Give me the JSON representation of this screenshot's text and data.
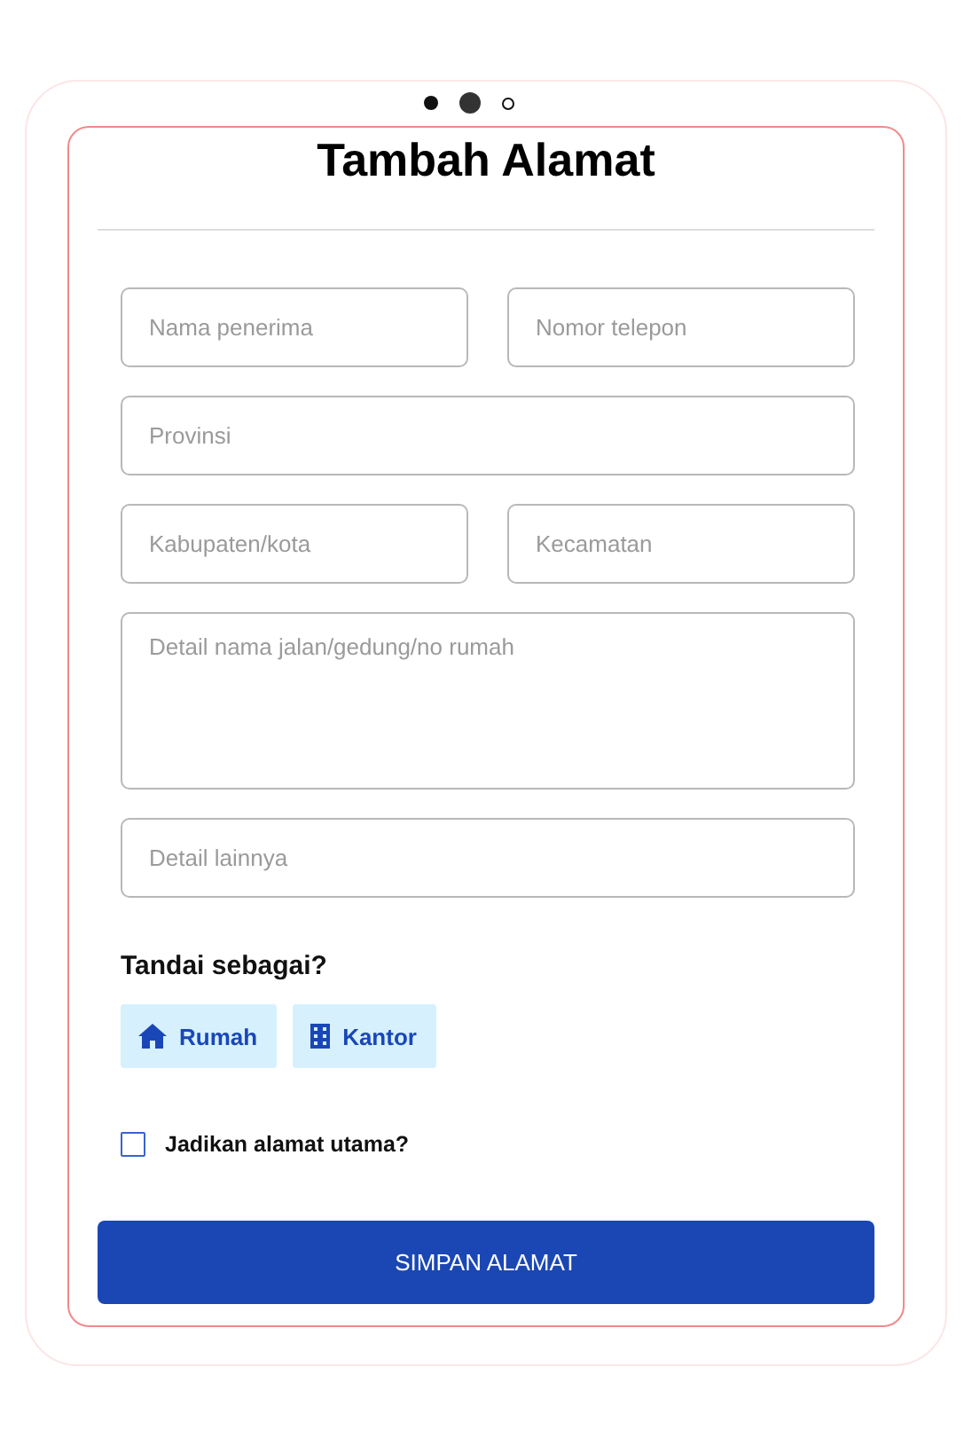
{
  "title": "Tambah Alamat",
  "fields": [
    {
      "placeholder": "Nama penerima",
      "kind": "half"
    },
    {
      "placeholder": "Nomor telepon",
      "kind": "half"
    },
    {
      "placeholder": "Provinsi",
      "kind": "full"
    },
    {
      "placeholder": "Kabupaten/kota",
      "kind": "half"
    },
    {
      "placeholder": "Kecamatan",
      "kind": "half"
    },
    {
      "placeholder": "Detail nama jalan/gedung/no rumah",
      "kind": "textarea"
    },
    {
      "placeholder": "Detail lainnya",
      "kind": "full"
    }
  ],
  "tag_section": {
    "label": "Tandai sebagai?",
    "tags": [
      {
        "label": "Rumah",
        "kind": "house",
        "selected": false
      },
      {
        "label": "Kantor",
        "kind": "building",
        "selected": false
      }
    ]
  },
  "primary_checkbox": {
    "label": "Jadikan alamat utama?",
    "checked": false
  },
  "submit_button": "SIMPAN ALAMAT"
}
